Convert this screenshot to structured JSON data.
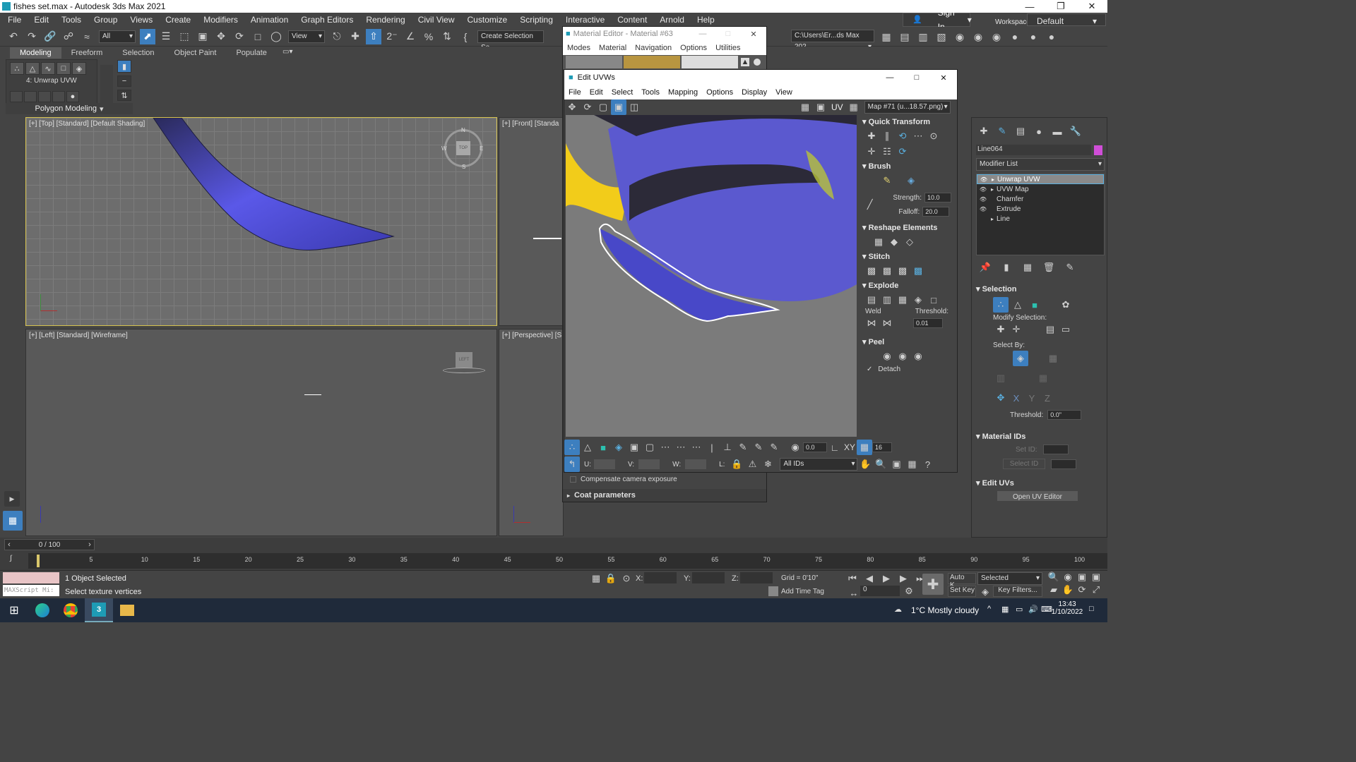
{
  "app": {
    "title": "fishes set.max - Autodesk 3ds Max 2021"
  },
  "menu": [
    "File",
    "Edit",
    "Tools",
    "Group",
    "Views",
    "Create",
    "Modifiers",
    "Animation",
    "Graph Editors",
    "Rendering",
    "Civil View",
    "Customize",
    "Scripting",
    "Interactive",
    "Content",
    "Arnold",
    "Help"
  ],
  "account": {
    "sign_in": "Sign In",
    "workspaces_label": "Workspaces:",
    "workspace": "Default"
  },
  "toolbar": {
    "filter": "All",
    "view": "View",
    "selection_set": "Create Selection Se",
    "path": "C:\\Users\\Er...ds Max 202"
  },
  "ribbon": {
    "tabs": [
      "Modeling",
      "Freeform",
      "Selection",
      "Object Paint",
      "Populate"
    ],
    "modifier_label": "4: Unwrap UVW",
    "group_label": "Polygon Modeling"
  },
  "viewports": {
    "top": "[+] [Top] [Standard] [Default Shading]",
    "front": "[+] [Front] [Standa",
    "left": "[+] [Left] [Standard] [Wireframe]",
    "perspective": "[+] [Perspective] [S",
    "gizmo_top": "TOP",
    "gizmo_left": "LEFT",
    "compass": {
      "n": "N",
      "s": "S",
      "e": "E",
      "w": "W"
    }
  },
  "material_editor": {
    "title": "Material Editor - Material #63",
    "menu": [
      "Modes",
      "Material",
      "Navigation",
      "Options",
      "Utilities"
    ],
    "compensate": "Compensate camera exposure",
    "coat": "Coat parameters"
  },
  "uv_editor": {
    "title": "Edit UVWs",
    "menu": [
      "File",
      "Edit",
      "Select",
      "Tools",
      "Mapping",
      "Options",
      "Display",
      "View"
    ],
    "uv_label": "UV",
    "map": "Map #71 (u...18.57.png)",
    "quick_transform": "Quick Transform",
    "brush": "Brush",
    "strength_label": "Strength:",
    "strength": "10.0",
    "falloff_label": "Falloff:",
    "falloff": "20.0",
    "reshape": "Reshape Elements",
    "stitch": "Stitch",
    "explode": "Explode",
    "weld": "Weld",
    "threshold_label": "Threshold:",
    "threshold": "0.01",
    "peel": "Peel",
    "detach": "Detach",
    "bottom_value": "0.0",
    "xy": "XY",
    "grid_count": "16",
    "u": "U:",
    "v": "V:",
    "w": "W:",
    "l": "L:",
    "ids": "All IDs"
  },
  "command_panel": {
    "object_name": "Line064",
    "modifier_list": "Modifier List",
    "stack": [
      "Unwrap UVW",
      "UVW Map",
      "Chamfer",
      "Extrude",
      "Line"
    ],
    "selection": "Selection",
    "modify_selection": "Modify Selection:",
    "select_by": "Select By:",
    "threshold_label": "Threshold:",
    "threshold": "0.0\"",
    "material_ids": "Material IDs",
    "set_id": "Set ID:",
    "select_id": "Select ID",
    "edit_uvs": "Edit UVs",
    "open_uv_editor": "Open UV Editor"
  },
  "timeline": {
    "frame": "0 / 100",
    "ticks": [
      "5",
      "10",
      "15",
      "20",
      "25",
      "30",
      "35",
      "40",
      "45",
      "50",
      "55",
      "60",
      "65",
      "70",
      "75",
      "80",
      "85",
      "90",
      "95",
      "100"
    ]
  },
  "status": {
    "script": "MAXScript Mi:",
    "objects": "1 Object Selected",
    "prompt": "Select texture vertices",
    "x": "X:",
    "y": "Y:",
    "z": "Z:",
    "grid": "Grid = 0'10\"",
    "add_time_tag": "Add Time Tag",
    "auto_key": "Auto K...",
    "selected": "Selected",
    "set_key": "Set Key",
    "key_filters": "Key Filters...",
    "frame_field": "0"
  },
  "taskbar": {
    "weather": "1°C  Mostly cloudy",
    "time": "13:43",
    "date": "1/10/2022"
  },
  "colors": {
    "accent": "#3d7fbf",
    "fish_blue": "#4b4ad8",
    "fish_yellow": "#f2cc1a",
    "sample_swatch": "#e8c4c6"
  }
}
